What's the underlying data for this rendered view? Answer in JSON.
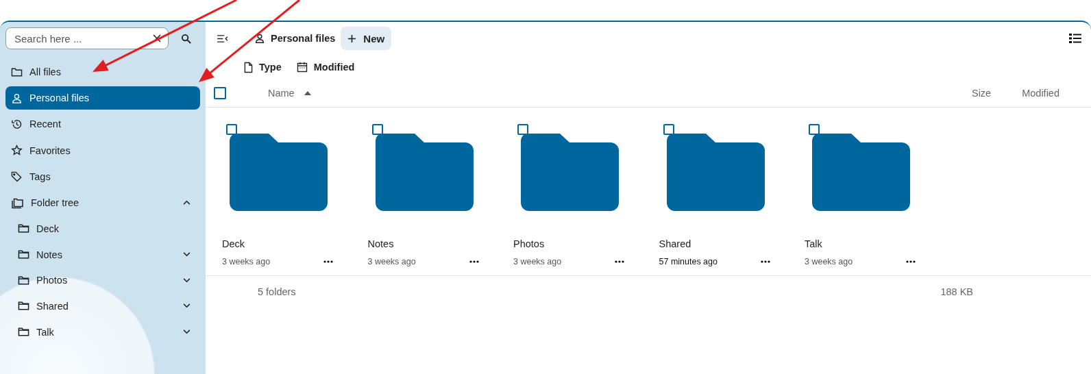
{
  "sidebar": {
    "search": {
      "placeholder": "Search here ..."
    },
    "items": [
      {
        "label": "All files",
        "selected": false
      },
      {
        "label": "Personal files",
        "selected": true
      },
      {
        "label": "Recent",
        "selected": false
      },
      {
        "label": "Favorites",
        "selected": false
      },
      {
        "label": "Tags",
        "selected": false
      }
    ],
    "folder_tree": {
      "label": "Folder tree",
      "expanded": true,
      "children": [
        {
          "label": "Deck",
          "expandable": false
        },
        {
          "label": "Notes",
          "expandable": true
        },
        {
          "label": "Photos",
          "expandable": true
        },
        {
          "label": "Shared",
          "expandable": true
        },
        {
          "label": "Talk",
          "expandable": true
        }
      ]
    }
  },
  "header": {
    "breadcrumb": "Personal files",
    "new_button": "New"
  },
  "filters": [
    {
      "label": "Type"
    },
    {
      "label": "Modified"
    }
  ],
  "table": {
    "columns": [
      "Name",
      "Size",
      "Modified"
    ],
    "sort_ascending": true,
    "all_checked": false
  },
  "folders": [
    {
      "name": "Deck",
      "modified": "3 weeks ago",
      "recent": false,
      "checked": false
    },
    {
      "name": "Notes",
      "modified": "3 weeks ago",
      "recent": false,
      "checked": false
    },
    {
      "name": "Photos",
      "modified": "3 weeks ago",
      "recent": false,
      "checked": false
    },
    {
      "name": "Shared",
      "modified": "57 minutes ago",
      "recent": true,
      "checked": false
    },
    {
      "name": "Talk",
      "modified": "3 weeks ago",
      "recent": false,
      "checked": false
    }
  ],
  "summary": {
    "count": "5 folders",
    "size": "188 KB"
  },
  "annotations": [
    {
      "kind": "arrow"
    },
    {
      "kind": "arrow"
    }
  ]
}
